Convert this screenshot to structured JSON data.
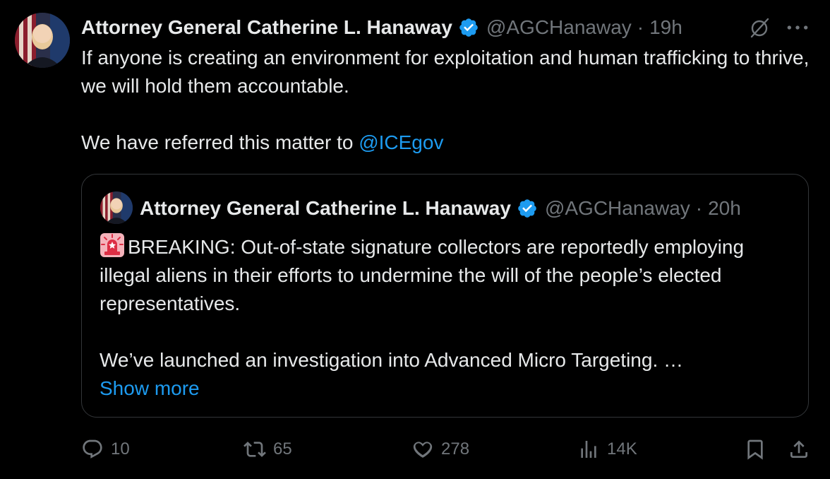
{
  "tweet": {
    "author_name": "Attorney General Catherine L. Hanaway",
    "handle": "@AGCHanaway",
    "separator": "·",
    "time": "19h",
    "more_label": "···",
    "text_line1": "If anyone is creating an environment for exploitation and human trafficking to thrive, we will hold them accountable.",
    "text_line2_prefix": "We have referred this matter to ",
    "mention": "@ICEgov"
  },
  "quoted": {
    "author_name": "Attorney General Catherine L. Hanaway",
    "handle": "@AGCHanaway",
    "separator": "·",
    "time": "20h",
    "para1": "BREAKING: Out-of-state signature collectors are reportedly employing illegal aliens in their efforts to undermine the will of the people’s elected representatives.",
    "para2": "We’ve launched an investigation into Advanced Micro Targeting. …",
    "show_more": "Show more"
  },
  "actions": {
    "replies": "10",
    "reposts": "65",
    "likes": "278",
    "views": "14K"
  },
  "colors": {
    "background": "#000000",
    "text": "#e7e9ea",
    "secondary": "#71767b",
    "accent": "#1d9bf0",
    "border": "#333639"
  },
  "icons": [
    "verified-badge-icon",
    "grok-icon",
    "more-icon",
    "siren-emoji-icon",
    "reply-icon",
    "repost-icon",
    "like-icon",
    "views-icon",
    "bookmark-icon",
    "share-icon"
  ]
}
